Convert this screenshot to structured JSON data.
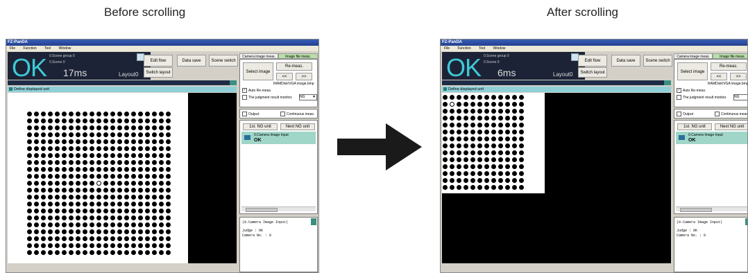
{
  "captions": {
    "before": "Before scrolling",
    "after": "After scrolling"
  },
  "app": {
    "title": "FZ-PanDA",
    "menu": [
      "File",
      "Function",
      "Tool",
      "Window"
    ],
    "status": "OK",
    "scene_group": "0.Scene group 0",
    "scene": "0.Scene 0",
    "layout": "Layout0",
    "buttons": {
      "edit_flow": "Edit flow",
      "data_save": "Data save",
      "scene_switch": "Scene switch",
      "switch_layout": "Switch layout"
    },
    "display_unit": "Define displayed unit",
    "tabs": {
      "camera": "Camera image meas.",
      "file": "Image file meas."
    },
    "select_image": "Select image",
    "remeas": "Re-meas.",
    "prev": "<<",
    "next": ">>",
    "ram_label": "RAMDisk\\VGA image.bmp",
    "auto_remeas": "Auto Re-meas.",
    "judgment_monitor": "The judgment result monitor.",
    "judgment_value": "NG",
    "output": "Output",
    "continuous": "Continuous meas.",
    "first_ng": "1st. NG unit",
    "next_ng": "Next NG unit",
    "unit_name": "0.Camera Image Input",
    "unit_status": "OK",
    "detail_title": "(0.Camera Image Input)",
    "detail_judge": "Judge : OK",
    "detail_camera": "Camera No. : 0"
  },
  "before": {
    "time": "17ms"
  },
  "after": {
    "time": "6ms"
  }
}
